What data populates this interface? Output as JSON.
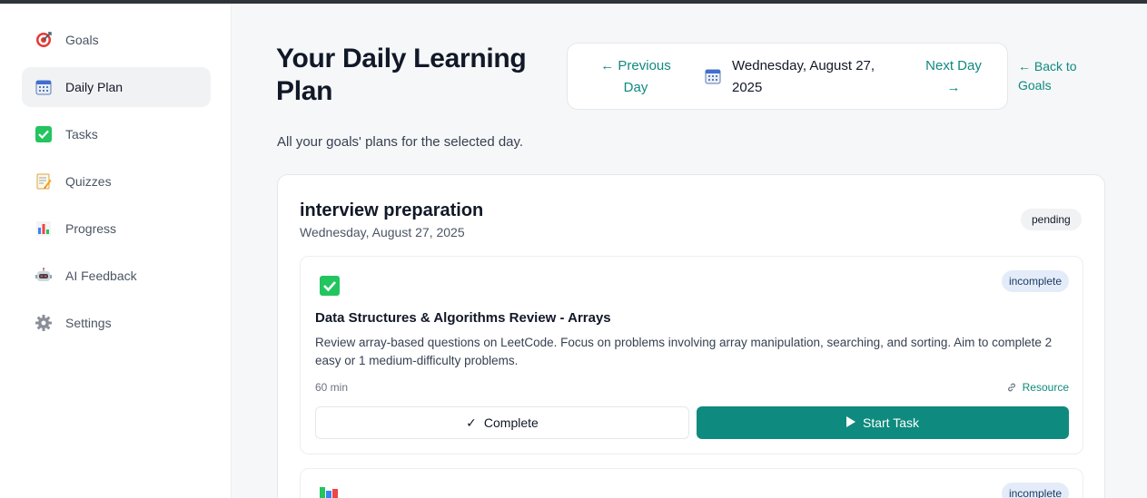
{
  "sidebar": {
    "items": [
      {
        "label": "Goals",
        "icon": "target-icon"
      },
      {
        "label": "Daily Plan",
        "icon": "calendar-icon",
        "active": true
      },
      {
        "label": "Tasks",
        "icon": "checkbox-icon"
      },
      {
        "label": "Quizzes",
        "icon": "memo-icon"
      },
      {
        "label": "Progress",
        "icon": "bar-chart-icon"
      },
      {
        "label": "AI Feedback",
        "icon": "robot-icon"
      },
      {
        "label": "Settings",
        "icon": "gear-icon"
      }
    ]
  },
  "header": {
    "title": "Your Daily Learning Plan",
    "subtitle": "All your goals' plans for the selected day.",
    "prev_day": "← Previous Day",
    "current_date": "Wednesday, August 27, 2025",
    "next_day": "Next Day →",
    "back_to_goals": "← Back to Goals"
  },
  "goal": {
    "title": "interview preparation",
    "date": "Wednesday, August 27, 2025",
    "status": "pending",
    "tasks": [
      {
        "title": "Data Structures & Algorithms Review - Arrays",
        "description": "Review array-based questions on LeetCode. Focus on problems involving array manipulation, searching, and sorting. Aim to complete 2 easy or 1 medium-difficulty problems.",
        "duration": "60 min",
        "resource_label": "Resource",
        "status": "incomplete",
        "complete_label": "Complete",
        "start_label": "Start Task"
      },
      {
        "status": "incomplete"
      }
    ]
  },
  "colors": {
    "accent": "#0f8a7e",
    "active_nav_bg": "#f1f2f4",
    "badge_incomplete_bg": "#e3ecf8"
  }
}
